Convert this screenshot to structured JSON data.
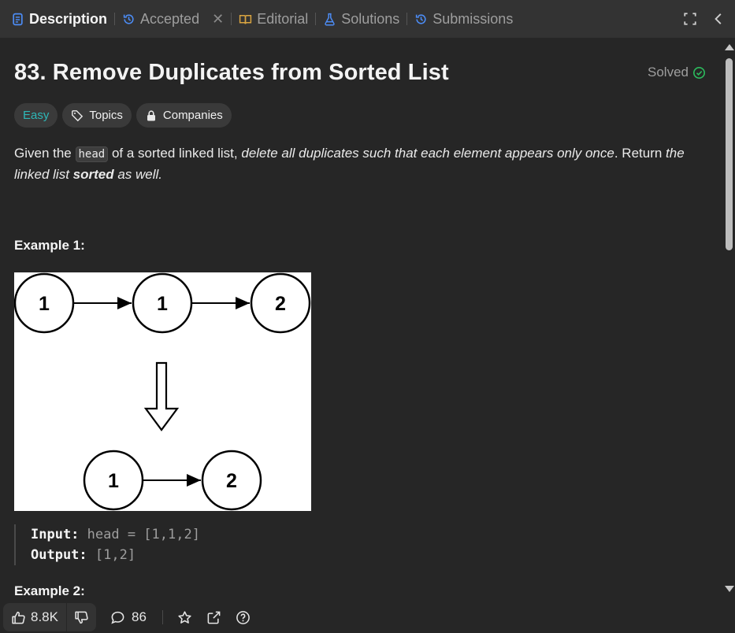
{
  "tabs": {
    "description": "Description",
    "accepted": "Accepted",
    "editorial": "Editorial",
    "solutions": "Solutions",
    "submissions": "Submissions"
  },
  "problem": {
    "title": "83. Remove Duplicates from Sorted List",
    "status": "Solved",
    "difficulty": "Easy",
    "topics_label": "Topics",
    "companies_label": "Companies"
  },
  "description": {
    "p1": "Given the ",
    "code": "head",
    "p2": " of a sorted linked list, ",
    "p3": "delete all duplicates such that each element appears only once",
    "p4": ". Return ",
    "p5": "the linked list ",
    "p6": "sorted",
    "p7": " as well."
  },
  "example1": {
    "heading": "Example 1:",
    "input_label": "Input:",
    "input_value": " head = [1,1,2]",
    "output_label": "Output:",
    "output_value": " [1,2]",
    "diagram": {
      "top_nodes": [
        "1",
        "1",
        "2"
      ],
      "bottom_nodes": [
        "1",
        "2"
      ]
    }
  },
  "example2": {
    "heading": "Example 2:"
  },
  "bottom": {
    "likes": "8.8K",
    "comments": "86"
  },
  "colors": {
    "background": "#262626",
    "tabbar": "#333333",
    "easy": "#2db7b7",
    "solved_check": "#2cbb5d",
    "tab_icon_blue": "#4c8cf5",
    "editorial_icon": "#d9a441"
  }
}
